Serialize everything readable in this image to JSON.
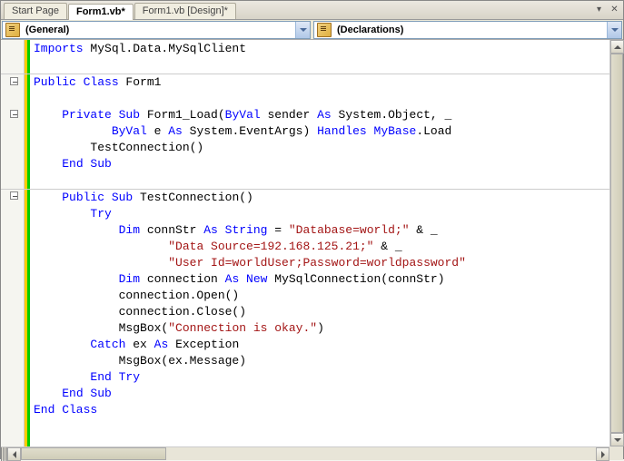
{
  "tabs": [
    {
      "label": "Start Page",
      "active": false
    },
    {
      "label": "Form1.vb*",
      "active": true
    },
    {
      "label": "Form1.vb [Design]*",
      "active": false
    }
  ],
  "dropdowns": {
    "left": "(General)",
    "right": "(Declarations)"
  },
  "code": {
    "tokens": [
      [
        {
          "t": "Imports",
          "c": "kw"
        },
        {
          "t": " MySql.Data.MySqlClient"
        }
      ],
      [],
      [
        {
          "t": "Public Class",
          "c": "kw"
        },
        {
          "t": " Form1"
        }
      ],
      [],
      [
        {
          "t": "    "
        },
        {
          "t": "Private Sub",
          "c": "kw"
        },
        {
          "t": " Form1_Load("
        },
        {
          "t": "ByVal",
          "c": "kw"
        },
        {
          "t": " sender "
        },
        {
          "t": "As",
          "c": "kw"
        },
        {
          "t": " System.Object, _"
        }
      ],
      [
        {
          "t": "           "
        },
        {
          "t": "ByVal",
          "c": "kw"
        },
        {
          "t": " e "
        },
        {
          "t": "As",
          "c": "kw"
        },
        {
          "t": " System.EventArgs) "
        },
        {
          "t": "Handles",
          "c": "kw"
        },
        {
          "t": " "
        },
        {
          "t": "MyBase",
          "c": "kw"
        },
        {
          "t": ".Load"
        }
      ],
      [
        {
          "t": "        TestConnection()"
        }
      ],
      [
        {
          "t": "    "
        },
        {
          "t": "End Sub",
          "c": "kw"
        }
      ],
      [],
      [
        {
          "t": "    "
        },
        {
          "t": "Public Sub",
          "c": "kw"
        },
        {
          "t": " TestConnection()"
        }
      ],
      [
        {
          "t": "        "
        },
        {
          "t": "Try",
          "c": "kw"
        }
      ],
      [
        {
          "t": "            "
        },
        {
          "t": "Dim",
          "c": "kw"
        },
        {
          "t": " connStr "
        },
        {
          "t": "As String",
          "c": "kw"
        },
        {
          "t": " = "
        },
        {
          "t": "\"Database=world;\"",
          "c": "str"
        },
        {
          "t": " & _"
        }
      ],
      [
        {
          "t": "                   "
        },
        {
          "t": "\"Data Source=192.168.125.21;\"",
          "c": "str"
        },
        {
          "t": " & _"
        }
      ],
      [
        {
          "t": "                   "
        },
        {
          "t": "\"User Id=worldUser;Password=worldpassword\"",
          "c": "str"
        }
      ],
      [
        {
          "t": "            "
        },
        {
          "t": "Dim",
          "c": "kw"
        },
        {
          "t": " connection "
        },
        {
          "t": "As New",
          "c": "kw"
        },
        {
          "t": " MySqlConnection(connStr)"
        }
      ],
      [
        {
          "t": "            connection.Open()"
        }
      ],
      [
        {
          "t": "            connection.Close()"
        }
      ],
      [
        {
          "t": "            MsgBox("
        },
        {
          "t": "\"Connection is okay.\"",
          "c": "str"
        },
        {
          "t": ")"
        }
      ],
      [
        {
          "t": "        "
        },
        {
          "t": "Catch",
          "c": "kw"
        },
        {
          "t": " ex "
        },
        {
          "t": "As",
          "c": "kw"
        },
        {
          "t": " Exception"
        }
      ],
      [
        {
          "t": "            MsgBox(ex.Message)"
        }
      ],
      [
        {
          "t": "        "
        },
        {
          "t": "End Try",
          "c": "kw"
        }
      ],
      [
        {
          "t": "    "
        },
        {
          "t": "End Sub",
          "c": "kw"
        }
      ],
      [
        {
          "t": "End Class",
          "c": "kw"
        }
      ]
    ]
  },
  "foldLines": [
    2,
    4,
    9
  ],
  "hrLines": [
    1,
    8
  ]
}
